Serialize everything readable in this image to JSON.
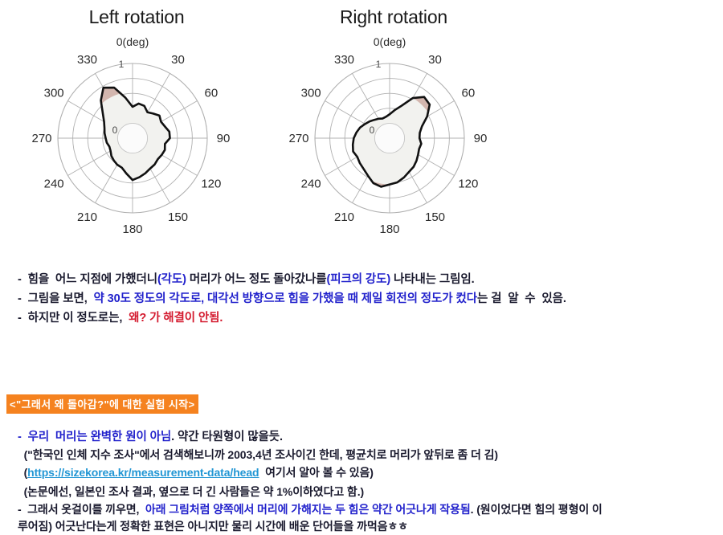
{
  "charts": {
    "left": {
      "title": "Left rotation",
      "angle_unit_label": "0(deg)",
      "r_min_label": "0",
      "r_max_label": "1",
      "tick_labels": [
        "30",
        "60",
        "90",
        "120",
        "150",
        "180",
        "210",
        "240",
        "270",
        "300",
        "330"
      ],
      "outline_color": "#111111",
      "fill_low_color": "#f2f2ef",
      "fill_mid_color": "#d3b6ae",
      "fill_high_color": "#a78279"
    },
    "right": {
      "title": "Right rotation",
      "angle_unit_label": "0(deg)",
      "r_min_label": "0",
      "r_max_label": "1",
      "tick_labels": [
        "30",
        "60",
        "90",
        "120",
        "150",
        "180",
        "210",
        "240",
        "270",
        "300",
        "330"
      ],
      "outline_color": "#111111",
      "fill_low_color": "#f2f2ef",
      "fill_mid_color": "#d3b6ae",
      "fill_high_color": "#a78279"
    }
  },
  "chart_data": [
    {
      "type": "line",
      "subtype": "polar-radar",
      "title": "Left rotation",
      "xlabel": "0(deg)",
      "ylabel": "",
      "rlim": [
        0,
        1
      ],
      "rticks": [
        0,
        1
      ],
      "rtick_labels": [
        "0",
        "1"
      ],
      "grid": true,
      "legend": "none",
      "theta_deg": [
        0,
        10,
        20,
        30,
        40,
        50,
        60,
        70,
        80,
        90,
        100,
        110,
        120,
        130,
        140,
        150,
        160,
        170,
        180,
        190,
        200,
        210,
        220,
        230,
        240,
        250,
        260,
        270,
        280,
        290,
        300,
        310,
        320,
        330,
        340,
        350
      ],
      "values": [
        0.42,
        0.47,
        0.46,
        0.4,
        0.43,
        0.47,
        0.44,
        0.46,
        0.5,
        0.5,
        0.44,
        0.46,
        0.45,
        0.44,
        0.46,
        0.47,
        0.5,
        0.53,
        0.56,
        0.48,
        0.42,
        0.41,
        0.39,
        0.37,
        0.34,
        0.33,
        0.35,
        0.36,
        0.38,
        0.4,
        0.44,
        0.52,
        0.66,
        0.78,
        0.72,
        0.55
      ]
    },
    {
      "type": "line",
      "subtype": "polar-radar",
      "title": "Right rotation",
      "xlabel": "0(deg)",
      "ylabel": "",
      "rlim": [
        0,
        1
      ],
      "rticks": [
        0,
        1
      ],
      "rtick_labels": [
        "0",
        "1"
      ],
      "grid": true,
      "legend": "none",
      "theta_deg": [
        0,
        10,
        20,
        30,
        40,
        50,
        60,
        70,
        80,
        90,
        100,
        110,
        120,
        130,
        140,
        150,
        160,
        170,
        180,
        190,
        200,
        210,
        220,
        230,
        240,
        250,
        260,
        270,
        280,
        290,
        300,
        310,
        320,
        330,
        340,
        350
      ],
      "values": [
        0.32,
        0.38,
        0.46,
        0.62,
        0.72,
        0.7,
        0.58,
        0.46,
        0.41,
        0.4,
        0.43,
        0.42,
        0.44,
        0.47,
        0.5,
        0.52,
        0.56,
        0.6,
        0.62,
        0.66,
        0.64,
        0.58,
        0.54,
        0.52,
        0.5,
        0.52,
        0.5,
        0.48,
        0.45,
        0.42,
        0.38,
        0.35,
        0.32,
        0.3,
        0.28,
        0.29
      ]
    }
  ],
  "notes_top": {
    "line1": [
      {
        "text": "-  힘을  어느 지점에 가했더니",
        "style": "dark"
      },
      {
        "text": "(각도)",
        "style": "blue"
      },
      {
        "text": " 머리가 어느 정도 돌아갔나를",
        "style": "dark"
      },
      {
        "text": "(피크의 강도)",
        "style": "blue"
      },
      {
        "text": " 나타내는 그림임.",
        "style": "dark"
      }
    ],
    "line2": [
      {
        "text": "-  그림을 보면,  ",
        "style": "dark"
      },
      {
        "text": "약 30도 정도의 각도로, 대각선 방향으로 힘을 가했을 때 제일 회전의 정도가 컸다",
        "style": "blue"
      },
      {
        "text": "는 걸  알  수  있음.",
        "style": "dark"
      }
    ],
    "line3": [
      {
        "text": "-  하지만 이 정도로는,  ",
        "style": "dark"
      },
      {
        "text": "왜? 가 해결이 안됨.",
        "style": "red"
      }
    ]
  },
  "heading_experiment": "<\"그래서 왜 돌아감?\"에 대한 실험 시작>",
  "notes_bottom": {
    "line1": [
      {
        "text": "-  우리  머리는 완벽한 원이 아님",
        "style": "blue"
      },
      {
        "text": ". 약간 타원형이 많을듯.",
        "style": "dark"
      }
    ],
    "line2": [
      {
        "text": "  (\"한국인 인체 지수 조사\"에서 검색해보니까 2003,4년 조사이긴 한데, 평균치로 머리가 앞뒤로 좀 더 김)",
        "style": "dark"
      }
    ],
    "line3_prefix": "  (",
    "line3_link": "https://sizekorea.kr/measurement-data/head",
    "line3_suffix": "  여기서 알아 볼 수 있음)",
    "line4": [
      {
        "text": "  (논문에선, 일본인 조사 결과, 옆으로 더 긴 사람들은 약 1%이하였다고 함.)",
        "style": "dark"
      }
    ],
    "line5": [
      {
        "text": "-  그래서 옷걸이를 끼우면,  ",
        "style": "dark"
      },
      {
        "text": "아래 그림처럼 양쪽에서 머리에 가해지는 두 힘은 약간 어긋나게 작용됨",
        "style": "blue"
      },
      {
        "text": ". (원이었다면 힘의 평형이 이",
        "style": "dark"
      }
    ],
    "line6": [
      {
        "text": "루어짐) 어긋난다는게 정확한 표현은 아니지만 물리 시간에 배운 단어들을 까먹음ㅎㅎ",
        "style": "dark"
      }
    ]
  },
  "colors": {
    "accent_orange": "#f5821f",
    "blue_text": "#2222cc",
    "red_text": "#d41a2e",
    "link_teal": "#2196d4"
  }
}
